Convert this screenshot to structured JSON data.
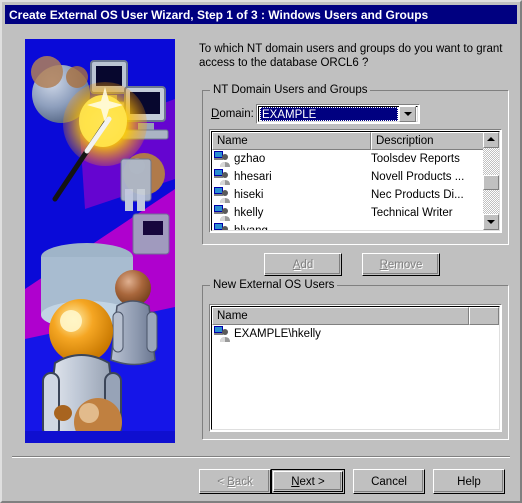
{
  "window": {
    "title": "Create External OS User Wizard, Step 1 of 3 : Windows Users and Groups"
  },
  "sidebar": {
    "image_name": "wizard-banner-illustration"
  },
  "main": {
    "instruction_line1": "To which NT domain users and groups do you want to grant",
    "instruction_line2": "access to the database ORCL6 ?",
    "domain_group": {
      "legend": "NT Domain Users and Groups",
      "domain_label_prefix": "D",
      "domain_label_rest": "omain:",
      "domain_value": "EXAMPLE",
      "columns": [
        "Name",
        "Description"
      ],
      "rows": [
        {
          "icon": "user-icon",
          "name": "gzhao",
          "description": "Toolsdev Reports"
        },
        {
          "icon": "user-icon",
          "name": "hhesari",
          "description": "Novell Products ..."
        },
        {
          "icon": "user-icon",
          "name": "hiseki",
          "description": "Nec Products Di..."
        },
        {
          "icon": "user-icon",
          "name": "hkelly",
          "description": "Technical Writer"
        },
        {
          "icon": "user-icon",
          "name": "hlyang",
          "description": ""
        }
      ]
    },
    "transfer_buttons": {
      "add_prefix": "A",
      "add_rest": "dd",
      "remove_prefix": "R",
      "remove_rest": "emove"
    },
    "new_users_group": {
      "legend": "New External OS Users",
      "columns": [
        "Name",
        ""
      ],
      "rows": [
        {
          "icon": "user-icon",
          "name": "EXAMPLE\\hkelly"
        }
      ]
    }
  },
  "footer": {
    "back_prefix": "< ",
    "back_key": "B",
    "back_rest": "ack",
    "next_key": "N",
    "next_rest": "ext >",
    "cancel_label": "Cancel",
    "help_label": "Help"
  },
  "colors": {
    "titlebar": "#000080",
    "face": "#c0c0c0",
    "highlight": "#000080",
    "disabled_text": "#808080",
    "window_white": "#ffffff"
  }
}
